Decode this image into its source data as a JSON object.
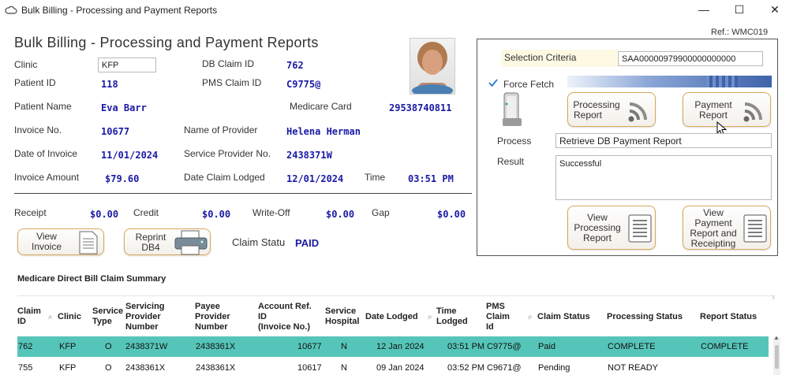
{
  "window": {
    "title": "Bulk Billing - Processing and Payment Reports",
    "minimize": "—",
    "maximize": "☐",
    "close": "✕"
  },
  "ref": "Ref.: WMC019",
  "form": {
    "heading": "Bulk Billing - Processing and Payment Reports",
    "clinic_label": "Clinic",
    "clinic_value": "KFP",
    "db_claim_id_label": "DB Claim ID",
    "db_claim_id_value": "762",
    "patient_id_label": "Patient ID",
    "patient_id_value": "118",
    "pms_claim_id_label": "PMS Claim ID",
    "pms_claim_id_value": "C9775@",
    "patient_name_label": "Patient Name",
    "patient_name_value": "Eva Barr",
    "medicare_card_label": "Medicare Card",
    "medicare_card_value": "29538740811",
    "invoice_no_label": "Invoice No.",
    "invoice_no_value": "10677",
    "provider_name_label": "Name of Provider",
    "provider_name_value": "Helena Herman",
    "date_of_invoice_label": "Date of Invoice",
    "date_of_invoice_value": "11/01/2024",
    "service_provider_no_label": "Service Provider No.",
    "service_provider_no_value": "2438371W",
    "invoice_amount_label": "Invoice Amount",
    "invoice_amount_value": "$79.60",
    "date_claim_lodged_label": "Date Claim Lodged",
    "date_claim_lodged_value": "12/01/2024",
    "time_label": "Time",
    "time_value": "03:51 PM",
    "receipt_label": "Receipt",
    "receipt_value": "$0.00",
    "credit_label": "Credit",
    "credit_value": "$0.00",
    "writeoff_label": "Write-Off",
    "writeoff_value": "$0.00",
    "gap_label": "Gap",
    "gap_value": "$0.00",
    "view_invoice_line1": "View",
    "view_invoice_line2": "Invoice",
    "reprint_line1": "Reprint",
    "reprint_line2": "DB4",
    "claim_status_label": "Claim Statu",
    "claim_status_value": "PAID"
  },
  "panel": {
    "selection_criteria_label": "Selection Criteria",
    "selection_criteria_value": "SAA00000979900000000000",
    "force_fetch_label": "Force Fetch",
    "force_fetch_checked": true,
    "processing_report_line1": "Processing",
    "processing_report_line2": "Report",
    "payment_report_line1": "Payment",
    "payment_report_line2": "Report",
    "process_label": "Process",
    "process_value": "Retrieve DB Payment Report",
    "result_label": "Result",
    "result_value": "Successful",
    "view_processing_line1": "View",
    "view_processing_line2": "Processing",
    "view_processing_line3": "Report",
    "view_payment_line1": "View",
    "view_payment_line2": "Payment",
    "view_payment_line3": "Report and",
    "view_payment_line4": "Receipting"
  },
  "summary": {
    "title": "Medicare Direct Bill Claim Summary",
    "headers": {
      "claim_id": [
        "Claim",
        "ID"
      ],
      "clinic": "Clinic",
      "service_type": [
        "Service",
        "Type"
      ],
      "servicing_provider": [
        "Servicing",
        "Provider",
        "Number"
      ],
      "payee_provider": [
        "Payee",
        "Provider",
        "Number"
      ],
      "account_ref": [
        "Account Ref.",
        "ID",
        "(Invoice No.)"
      ],
      "service_hospital": [
        "Service",
        "Hospital"
      ],
      "date_lodged": "Date Lodged",
      "time_lodged": [
        "Time",
        "Lodged"
      ],
      "pms_claim_id": [
        "PMS",
        "Claim",
        "Id"
      ],
      "claim_status": "Claim Status",
      "processing_status": "Processing Status",
      "report_status": "Report Status"
    },
    "rows": [
      {
        "claim_id": "762",
        "clinic": "KFP",
        "service_type": "O",
        "servicing": "2438371W",
        "payee": "2438361X",
        "account_ref": "10677",
        "hospital": "N",
        "date_lodged": "12 Jan 2024",
        "time_lodged": "03:51 PM",
        "pms_claim": "C9775@",
        "claim_status": "Paid",
        "processing_status": "COMPLETE",
        "report_status": "COMPLETE"
      },
      {
        "claim_id": "755",
        "clinic": "KFP",
        "service_type": "O",
        "servicing": "2438361X",
        "payee": "2438361X",
        "account_ref": "10617",
        "hospital": "N",
        "date_lodged": "09 Jan 2024",
        "time_lodged": "03:52 PM",
        "pms_claim": "C9671@",
        "claim_status": "Pending",
        "processing_status": "NOT READY",
        "report_status": ""
      }
    ]
  },
  "colors": {
    "accent_value": "#1a1aa6",
    "selected_row": "#56c5b9",
    "button_border": "#d9a85a"
  }
}
